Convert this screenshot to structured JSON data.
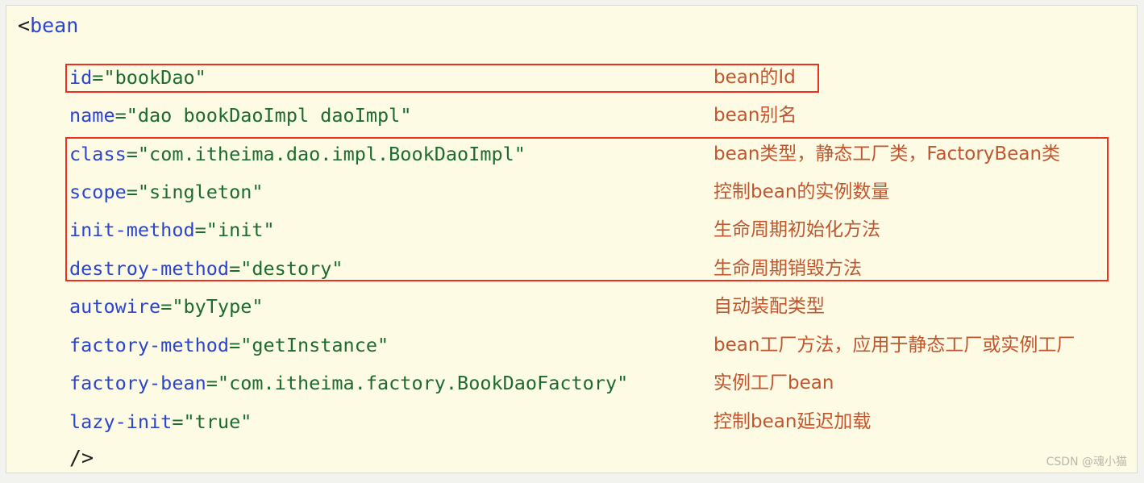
{
  "colors": {
    "page_background": "#fdfbe4",
    "outer_frame": "#f2f2ee",
    "attribute_name": "#2b45cf",
    "attribute_value": "#1c6b2f",
    "annotation_text": "#c0562f",
    "highlight_border": "#ee2f22",
    "watermark": "#b9b9ad"
  },
  "code": {
    "open_tag_bracket": "<",
    "open_tag_name": "bean",
    "close_tag": "/>"
  },
  "rows": [
    {
      "attr": "id",
      "eq_quote_open": "=\"",
      "value": "bookDao",
      "quote_close": "\"",
      "note": "bean的Id",
      "highlighted": true
    },
    {
      "attr": "name",
      "eq_quote_open": "=\"",
      "value": "dao bookDaoImpl daoImpl",
      "quote_close": "\"",
      "note": "bean别名",
      "highlighted": false
    },
    {
      "attr": "class",
      "eq_quote_open": "=\"",
      "value": "com.itheima.dao.impl.BookDaoImpl",
      "quote_close": "\"",
      "note": "bean类型，静态工厂类，FactoryBean类",
      "highlighted": true
    },
    {
      "attr": "scope",
      "eq_quote_open": "=\"",
      "value": "singleton",
      "quote_close": "\"",
      "note": "控制bean的实例数量",
      "highlighted": true
    },
    {
      "attr": "init-method",
      "eq_quote_open": "=\"",
      "value": "init",
      "quote_close": "\"",
      "note": "生命周期初始化方法",
      "highlighted": true
    },
    {
      "attr": "destroy-method",
      "eq_quote_open": "=\"",
      "value": "destory",
      "quote_close": "\"",
      "note": "生命周期销毁方法",
      "highlighted": true
    },
    {
      "attr": "autowire",
      "eq_quote_open": "=\"",
      "value": "byType",
      "quote_close": "\"",
      "note": "自动装配类型",
      "highlighted": false
    },
    {
      "attr": "factory-method",
      "eq_quote_open": "=\"",
      "value": "getInstance",
      "quote_close": "\"",
      "note": "bean工厂方法，应用于静态工厂或实例工厂",
      "highlighted": false
    },
    {
      "attr": "factory-bean",
      "eq_quote_open": "=\"",
      "value": "com.itheima.factory.BookDaoFactory",
      "quote_close": "\"",
      "note": "实例工厂bean",
      "highlighted": false
    },
    {
      "attr": "lazy-init",
      "eq_quote_open": "=\"",
      "value": "true",
      "quote_close": "\"",
      "note": "控制bean延迟加载",
      "highlighted": false
    }
  ],
  "highlights": [
    {
      "name": "id-row-highlight",
      "rows": [
        "id"
      ]
    },
    {
      "name": "bean-definition-group-highlight",
      "rows": [
        "class",
        "scope",
        "init-method",
        "destroy-method"
      ]
    }
  ],
  "watermark": {
    "text": "CSDN @魂小猫"
  }
}
